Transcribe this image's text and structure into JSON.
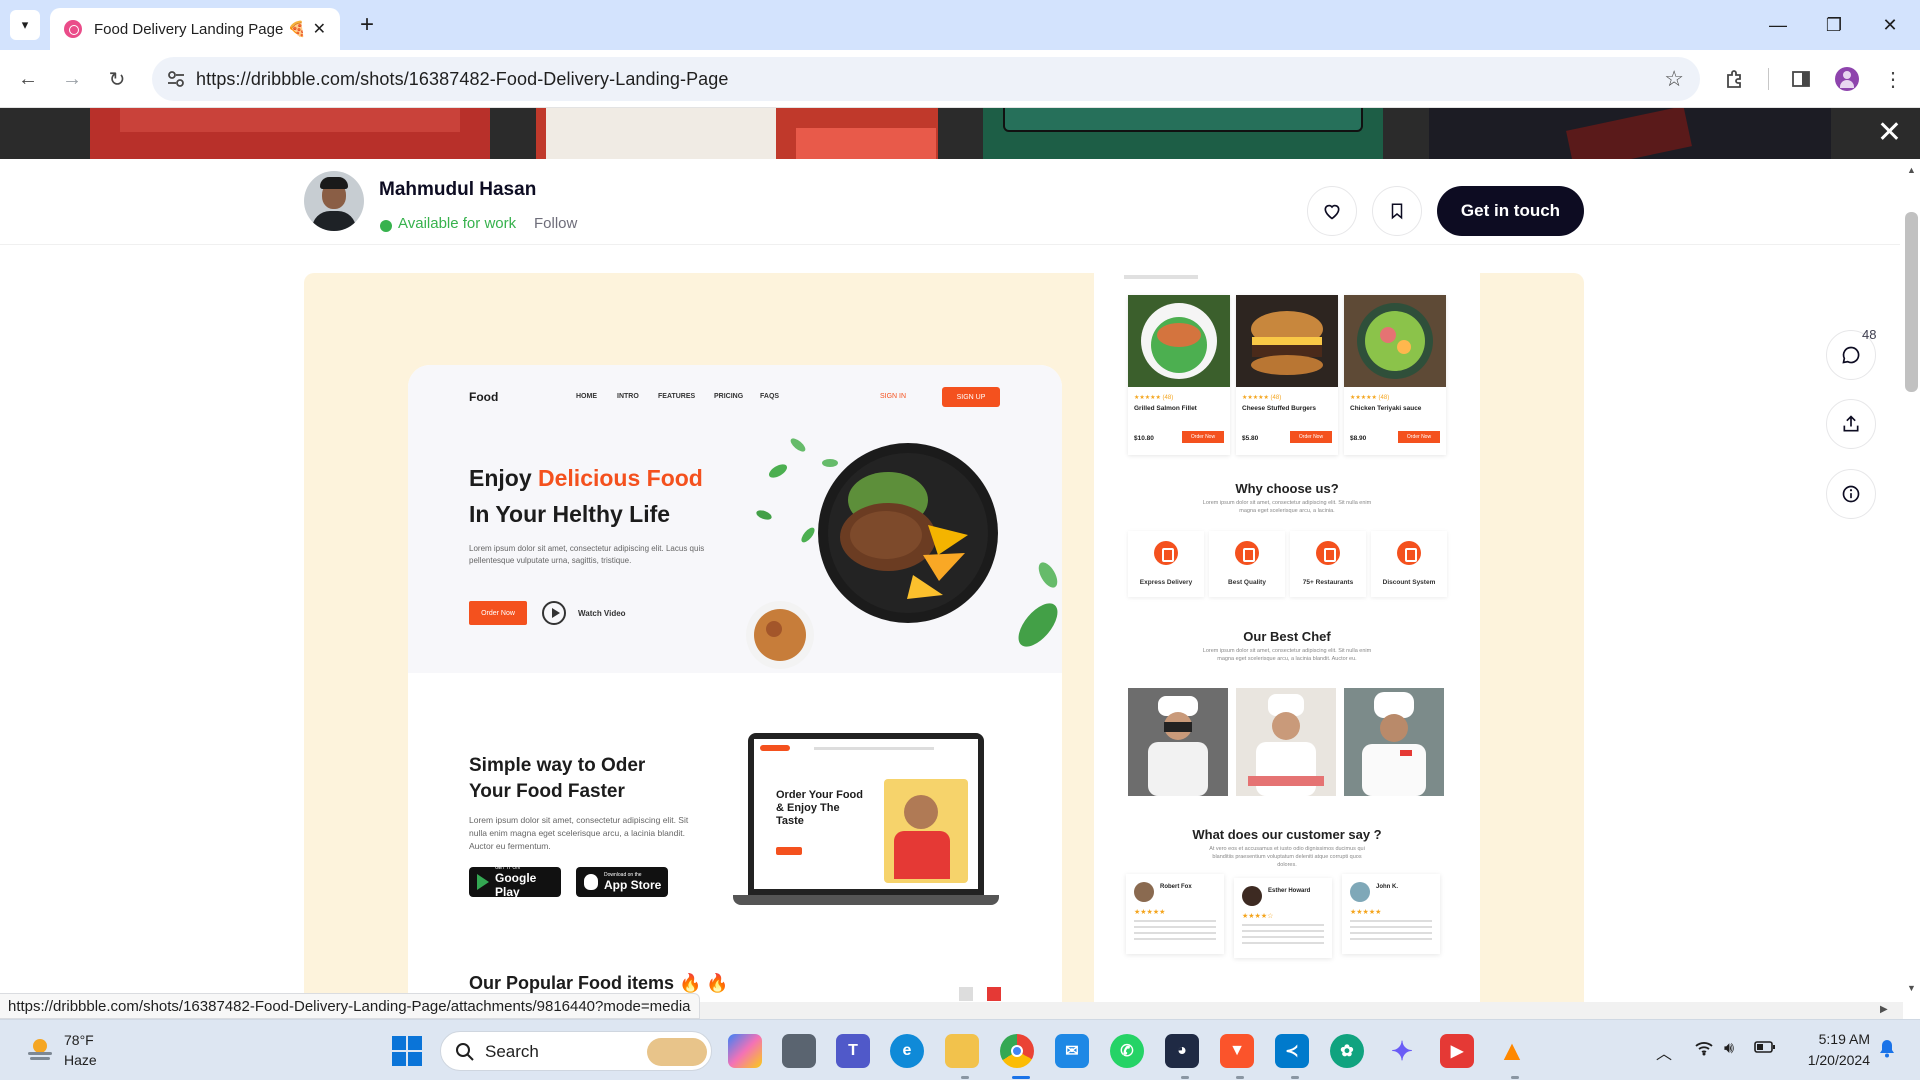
{
  "browser": {
    "tab_title": "Food Delivery Landing Page 🍕",
    "url": "https://dribbble.com/shots/16387482-Food-Delivery-Landing-Page",
    "status_url": "https://dribbble.com/shots/16387482-Food-Delivery-Landing-Page/attachments/9816440?mode=media"
  },
  "shot_header": {
    "author_name": "Mahmudul Hasan",
    "availability": "Available for work",
    "follow_label": "Follow",
    "cta_label": "Get in touch"
  },
  "rail": {
    "comment_count": "48"
  },
  "mock_hero": {
    "logo": "Food",
    "nav": [
      "HOME",
      "INTRO",
      "FEATURES",
      "PRICING",
      "FAQS"
    ],
    "signin": "SIGN IN",
    "signup": "SIGN UP",
    "headline_plain": "Enjoy ",
    "headline_accent": "Delicious Food",
    "headline_line2": "In Your Helthy Life",
    "body": "Lorem ipsum dolor sit amet, consectetur adipiscing elit. Lacus quis pellentesque vulputate urna, sagittis, tristique.",
    "order_btn": "Order Now",
    "watch": "Watch Video"
  },
  "mock_section2": {
    "title_line1": "Simple way to Oder",
    "title_line2": "Your Food Faster",
    "body": "Lorem ipsum dolor sit amet, consectetur adipiscing elit. Sit nulla enim magna eget scelerisque arcu, a lacinia blandit. Auctor eu fermentum.",
    "google_small": "GET IT ON",
    "google_big": "Google Play",
    "apple_small": "Download on the",
    "apple_big": "App Store",
    "laptop_title": "Order Your Food & Enjoy The Taste",
    "popular_title": "Our Popular Food items 🔥 🔥"
  },
  "mock_right": {
    "foods": [
      {
        "name": "Grilled Salmon Fillet",
        "price": "$10.80",
        "btn": "Order Now",
        "stars": "★★★★★ (48)"
      },
      {
        "name": "Cheese Stuffed Burgers",
        "price": "$5.80",
        "btn": "Order Now",
        "stars": "★★★★★ (48)"
      },
      {
        "name": "Chicken Teriyaki sauce",
        "price": "$8.90",
        "btn": "Order Now",
        "stars": "★★★★★ (48)"
      }
    ],
    "why_title": "Why choose us?",
    "why_body": "Lorem ipsum dolor sit amet, consectetur adipiscing elit. Sit nulla enim magna eget scelerisque arcu, a lacinia.",
    "features": [
      "Express Delivery",
      "Best Quality",
      "75+ Restaurants",
      "Discount System"
    ],
    "chef_title": "Our Best Chef",
    "chef_body": "Lorem ipsum dolor sit amet, consectetur adipiscing elit. Sit nulla enim magna eget scelerisque arcu, a lacinia blandit. Auctor eu.",
    "review_title": "What does our customer say ?",
    "review_body": "At vero eos et accusamus et iusto odio dignissimos ducimus qui blanditiis praesentium voluptatum deleniti atque corrupti quos dolores.",
    "reviewers": [
      "Robert Fox",
      "Esther Howard",
      "John K."
    ]
  },
  "taskbar": {
    "temp": "78°F",
    "condition": "Haze",
    "search_label": "Search",
    "time": "5:19 AM",
    "date": "1/20/2024"
  },
  "colors": {
    "accent": "#f4511e",
    "dribbble_pink": "#ea4c89",
    "cta_dark": "#0d0c22",
    "available_green": "#37b24d"
  }
}
